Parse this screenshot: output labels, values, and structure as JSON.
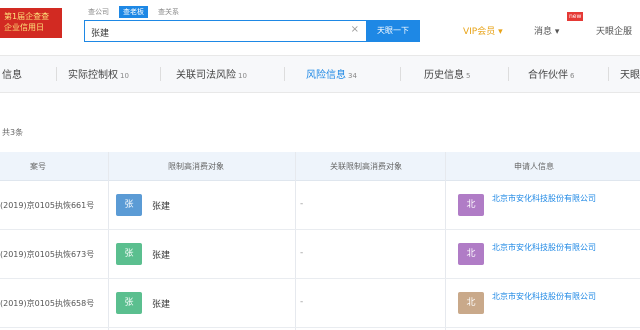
{
  "header": {
    "logo_line1": "第1届企查查",
    "logo_line2": "企业信用日",
    "search_tabs": [
      "查公司",
      "查老板",
      "查关系"
    ],
    "search_value": "张建",
    "search_button": "天眼一下",
    "vip_label": "VIP会员",
    "notice_label": "消息",
    "new_badge": "new",
    "user_label": "天眼企服"
  },
  "nav": {
    "items": [
      {
        "label": "信息",
        "count": ""
      },
      {
        "label": "实际控制权",
        "count": "10"
      },
      {
        "label": "关联司法风险",
        "count": "10"
      },
      {
        "label": "风险信息",
        "count": "34"
      },
      {
        "label": "历史信息",
        "count": "5"
      },
      {
        "label": "合作伙伴",
        "count": "6"
      },
      {
        "label": "天眼",
        "count": ""
      }
    ],
    "active_index": 3
  },
  "count_line": "共3条",
  "table": {
    "headers": [
      "案号",
      "限制高消费对象",
      "关联限制高消费对象",
      "申请人信息"
    ],
    "rows": [
      {
        "case_no": "(2019)京0105执恢661号",
        "avatar_char": "张",
        "avatar_color": "#5b9bd5",
        "person": "张建",
        "related": "-",
        "app_avatar_char": "北",
        "app_avatar_color": "#b07cc6",
        "applicant": "北京市安化科技股份有限公司"
      },
      {
        "case_no": "(2019)京0105执恢673号",
        "avatar_char": "张",
        "avatar_color": "#5bbf8f",
        "person": "张建",
        "related": "-",
        "app_avatar_char": "北",
        "app_avatar_color": "#b07cc6",
        "applicant": "北京市安化科技股份有限公司"
      },
      {
        "case_no": "(2019)京0105执恢658号",
        "avatar_char": "张",
        "avatar_color": "#5bbf8f",
        "person": "张建",
        "related": "-",
        "app_avatar_char": "北",
        "app_avatar_color": "#c9a98a",
        "applicant": "北京市安化科技股份有限公司"
      }
    ]
  }
}
